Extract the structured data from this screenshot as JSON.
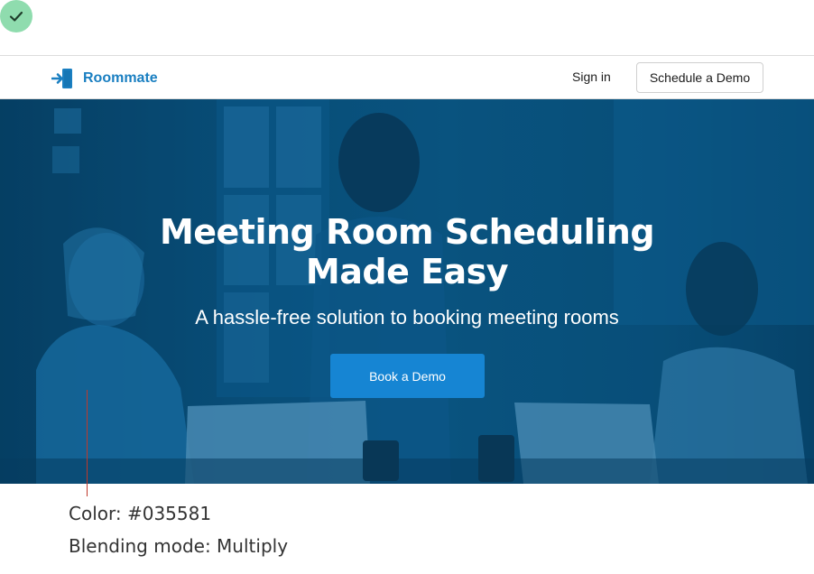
{
  "status": {
    "icon": "check-icon",
    "color": "#8fdcae"
  },
  "navbar": {
    "brand": "Roommate",
    "brand_color": "#1a7fc1",
    "signin_label": "Sign in",
    "demo_label": "Schedule a Demo"
  },
  "hero": {
    "title_line1": "Meeting Room Scheduling",
    "title_line2": "Made Easy",
    "subtitle": "A hassle-free solution to booking meeting rooms",
    "cta_label": "Book a Demo",
    "cta_color": "#1685d3",
    "overlay_color": "#035581"
  },
  "annotation": {
    "color_label": "Color: #035581",
    "blend_label": "Blending mode: Multiply"
  }
}
